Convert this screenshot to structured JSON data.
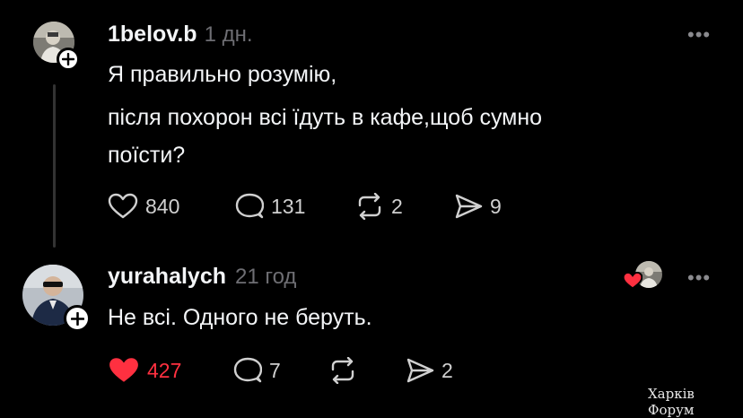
{
  "post": {
    "username": "1belov.b",
    "time": "1 дн.",
    "text_line1": "Я правильно розумію,",
    "text_line2": "після похорон всі їдуть в кафе,щоб сумно",
    "text_line3": "поїсти?",
    "likes": "840",
    "comments": "131",
    "reposts": "2",
    "shares": "9",
    "more": "•••"
  },
  "reply": {
    "username": "yurahalych",
    "time": "21 год",
    "text": "Не всі. Одного не беруть.",
    "likes": "427",
    "comments": "7",
    "shares": "2",
    "more": "•••",
    "liked": true
  },
  "watermark": "Харків Форум",
  "colors": {
    "like_active": "#ff3040",
    "muted": "#6e6e73",
    "text": "#f3f5f7"
  }
}
